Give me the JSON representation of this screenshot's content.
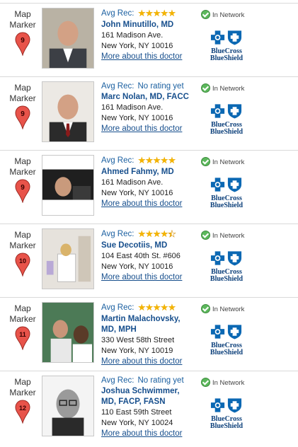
{
  "labels": {
    "avg_rec": "Avg Rec:",
    "no_rating": "No rating yet",
    "more_link": "More about this doctor",
    "in_network": "In Network",
    "map_marker_line1": "Map",
    "map_marker_line2": "Marker",
    "insurer_line1": "BlueCross",
    "insurer_line2": "BlueShield"
  },
  "colors": {
    "link_blue": "#174f8d",
    "star_gold": "#f4b400",
    "pin_red": "#e8534a",
    "check_green": "#5cb85c",
    "bcbs_blue": "#0b68b3"
  },
  "doctors": [
    {
      "marker_number": "9",
      "rating_stars": 5,
      "name_lines": [
        "John Minutillo, MD"
      ],
      "address_lines": [
        "161 Madison Ave.",
        "New York, NY  10016"
      ],
      "photo": "doctor-headshot-suit"
    },
    {
      "marker_number": "9",
      "rating_stars": null,
      "name_lines": [
        "Marc Nolan, MD, FACC"
      ],
      "address_lines": [
        "161 Madison Ave.",
        "New York, NY  10016"
      ],
      "photo": "doctor-headshot-tie"
    },
    {
      "marker_number": "9",
      "rating_stars": 5,
      "name_lines": [
        "Ahmed Fahmy, MD"
      ],
      "address_lines": [
        "161 Madison Ave.",
        "New York, NY  10016"
      ],
      "photo": "doctor-headshot-dark"
    },
    {
      "marker_number": "10",
      "rating_stars": 4.5,
      "name_lines": [
        "Sue Decotiis, MD"
      ],
      "address_lines": [
        "104 East 40th St. #606",
        "New York, NY  10016"
      ],
      "photo": "doctor-in-office"
    },
    {
      "marker_number": "11",
      "rating_stars": 5,
      "name_lines": [
        "Martin Malachovsky,",
        "MD, MPH"
      ],
      "address_lines": [
        "330 West 58th Street",
        "New York, NY  10019"
      ],
      "photo": "doctor-with-patient"
    },
    {
      "marker_number": "12",
      "rating_stars": null,
      "name_lines": [
        "Joshua Schwimmer,",
        "MD, FACP, FASN"
      ],
      "address_lines": [
        "110 East 59th Street",
        "New York, NY  10024"
      ],
      "photo": "doctor-bw-glasses"
    }
  ]
}
